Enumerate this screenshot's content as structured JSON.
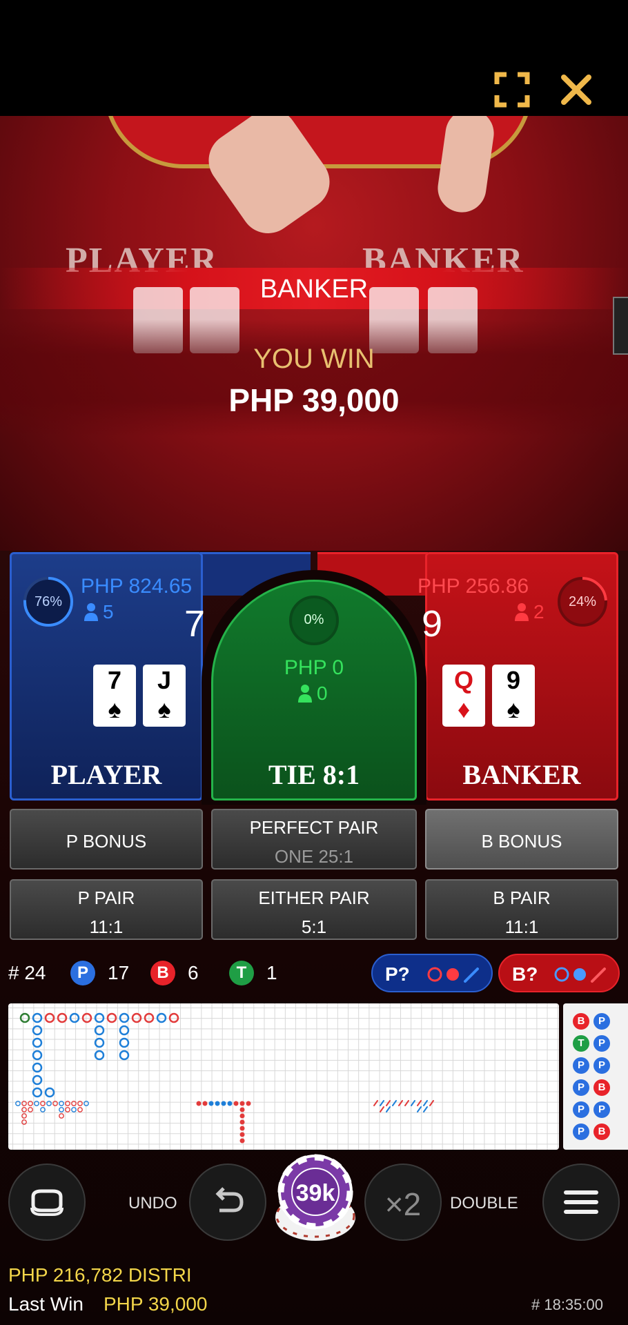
{
  "video": {
    "felt_player": "PLAYER",
    "felt_banker": "BANKER",
    "result": "BANKER",
    "you_win": "YOU WIN",
    "win_amount": "PHP 39,000"
  },
  "player": {
    "percent": "76%",
    "percent_value": 76,
    "amount": "PHP 824.65",
    "players": "5",
    "score": "7",
    "cards": [
      {
        "rank": "7",
        "suit": "♠"
      },
      {
        "rank": "J",
        "suit": "♠"
      }
    ],
    "label": "PLAYER"
  },
  "tie": {
    "percent": "0%",
    "percent_value": 0,
    "amount": "PHP 0",
    "players": "0",
    "label": "TIE 8:1"
  },
  "banker": {
    "percent": "24%",
    "percent_value": 24,
    "amount": "PHP 256.86",
    "players": "2",
    "score": "9",
    "cards": [
      {
        "rank": "Q",
        "suit": "♦"
      },
      {
        "rank": "9",
        "suit": "♠"
      }
    ],
    "label": "BANKER"
  },
  "side_bets": {
    "p_bonus": "P BONUS",
    "perfect_pair": "PERFECT PAIR",
    "perfect_pair_payout": "ONE 25:1",
    "b_bonus": "B BONUS",
    "p_pair": "P PAIR",
    "p_pair_payout": "11:1",
    "either_pair": "EITHER PAIR",
    "either_pair_payout": "5:1",
    "b_pair": "B PAIR",
    "b_pair_payout": "11:1"
  },
  "stats": {
    "round": "# 24",
    "p_letter": "P",
    "p_count": "17",
    "b_letter": "B",
    "b_count": "6",
    "t_letter": "T",
    "t_count": "1",
    "p_predict": "P?",
    "b_predict": "B?"
  },
  "colors": {
    "player_blue": "#2b6fe0",
    "banker_red": "#e8232a",
    "tie_green": "#1f9e45",
    "gold": "#f3d64a"
  },
  "bead_road": [
    [
      "B",
      "P"
    ],
    [
      "T",
      "P"
    ],
    [
      "P",
      "P"
    ],
    [
      "P",
      "B"
    ],
    [
      "P",
      "P"
    ],
    [
      "P",
      "B"
    ]
  ],
  "controls": {
    "undo": "UNDO",
    "chip_value": "39k",
    "double_x": "×2",
    "double": "DOUBLE"
  },
  "footer": {
    "balance": "PHP 216,782 DISTRI",
    "last_win_label": "Last Win",
    "last_win_amount": "PHP 39,000",
    "round_id": "# 18:35:00"
  }
}
